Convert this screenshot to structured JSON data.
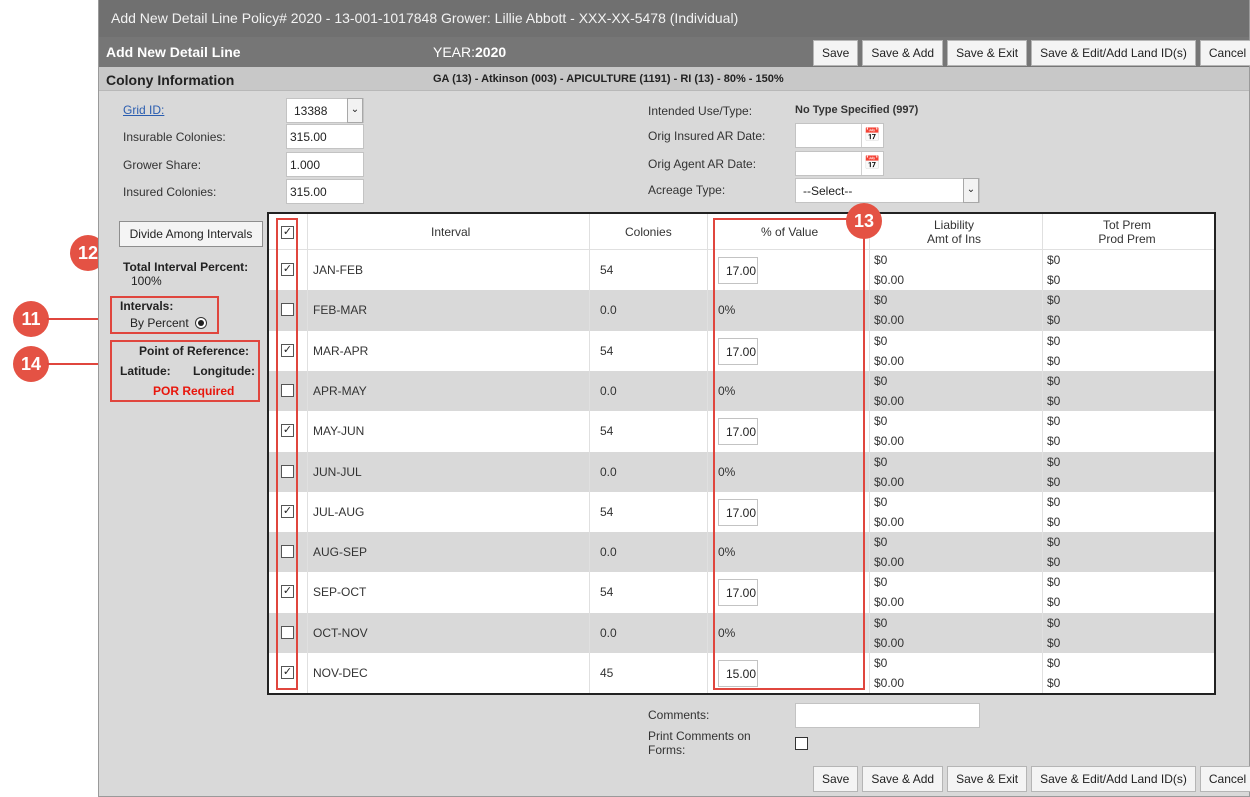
{
  "window_title": "Add New Detail Line Policy# 2020 - 13-001-1017848 Grower: Lillie Abbott - XXX-XX-5478 (Individual)",
  "header": {
    "title": "Add New Detail Line",
    "year_label": "YEAR:",
    "year_value": "2020",
    "buttons": [
      "Save",
      "Save & Add",
      "Save & Exit",
      "Save & Edit/Add Land ID(s)",
      "Cancel"
    ]
  },
  "section": {
    "title": "Colony Information",
    "info": "GA (13) - Atkinson (003) - APICULTURE (1191) - RI (13) - 80% - 150%"
  },
  "fields": {
    "grid_id_label": "Grid ID:",
    "grid_id_value": "13388",
    "insurable_colonies_label": "Insurable Colonies:",
    "insurable_colonies_value": "315.00",
    "grower_share_label": "Grower Share:",
    "grower_share_value": "1.000",
    "insured_colonies_label": "Insured Colonies:",
    "insured_colonies_value": "315.00",
    "intended_use_label": "Intended Use/Type:",
    "intended_use_value": "No Type Specified (997)",
    "orig_insured_ar_label": "Orig Insured AR Date:",
    "orig_agent_ar_label": "Orig Agent AR Date:",
    "acreage_type_label": "Acreage Type:",
    "acreage_type_value": "--Select--"
  },
  "left": {
    "divide_button": "Divide Among Intervals",
    "total_interval_label": "Total Interval Percent:",
    "total_interval_value": "100%",
    "intervals_label": "Intervals:",
    "by_percent_label": "By Percent",
    "por_label": "Point of Reference:",
    "latitude_label": "Latitude:",
    "longitude_label": "Longitude:",
    "por_required": "POR Required"
  },
  "table": {
    "headers": {
      "interval": "Interval",
      "colonies": "Colonies",
      "pct_value": "% of Value",
      "liability_1": "Liability",
      "liability_2": "Amt of Ins",
      "totprem_1": "Tot Prem",
      "totprem_2": "Prod Prem"
    },
    "rows": [
      {
        "interval": "JAN-FEB",
        "colonies": "54",
        "checked": true,
        "pct": "17.00",
        "liab1": "$0",
        "liab2": "$0.00",
        "prem1": "$0",
        "prem2": "$0"
      },
      {
        "interval": "FEB-MAR",
        "colonies": "0.0",
        "checked": false,
        "pct": "0%",
        "liab1": "$0",
        "liab2": "$0.00",
        "prem1": "$0",
        "prem2": "$0"
      },
      {
        "interval": "MAR-APR",
        "colonies": "54",
        "checked": true,
        "pct": "17.00",
        "liab1": "$0",
        "liab2": "$0.00",
        "prem1": "$0",
        "prem2": "$0"
      },
      {
        "interval": "APR-MAY",
        "colonies": "0.0",
        "checked": false,
        "pct": "0%",
        "liab1": "$0",
        "liab2": "$0.00",
        "prem1": "$0",
        "prem2": "$0"
      },
      {
        "interval": "MAY-JUN",
        "colonies": "54",
        "checked": true,
        "pct": "17.00",
        "liab1": "$0",
        "liab2": "$0.00",
        "prem1": "$0",
        "prem2": "$0"
      },
      {
        "interval": "JUN-JUL",
        "colonies": "0.0",
        "checked": false,
        "pct": "0%",
        "liab1": "$0",
        "liab2": "$0.00",
        "prem1": "$0",
        "prem2": "$0"
      },
      {
        "interval": "JUL-AUG",
        "colonies": "54",
        "checked": true,
        "pct": "17.00",
        "liab1": "$0",
        "liab2": "$0.00",
        "prem1": "$0",
        "prem2": "$0"
      },
      {
        "interval": "AUG-SEP",
        "colonies": "0.0",
        "checked": false,
        "pct": "0%",
        "liab1": "$0",
        "liab2": "$0.00",
        "prem1": "$0",
        "prem2": "$0"
      },
      {
        "interval": "SEP-OCT",
        "colonies": "54",
        "checked": true,
        "pct": "17.00",
        "liab1": "$0",
        "liab2": "$0.00",
        "prem1": "$0",
        "prem2": "$0"
      },
      {
        "interval": "OCT-NOV",
        "colonies": "0.0",
        "checked": false,
        "pct": "0%",
        "liab1": "$0",
        "liab2": "$0.00",
        "prem1": "$0",
        "prem2": "$0"
      },
      {
        "interval": "NOV-DEC",
        "colonies": "45",
        "checked": true,
        "pct": "15.00",
        "liab1": "$0",
        "liab2": "$0.00",
        "prem1": "$0",
        "prem2": "$0"
      }
    ]
  },
  "footer": {
    "comments_label": "Comments:",
    "print_comments_label_1": "Print Comments on",
    "print_comments_label_2": "Forms:"
  },
  "callouts": [
    "12",
    "11",
    "14",
    "13"
  ],
  "colors": {
    "accent": "#e45244",
    "header": "#767676",
    "title": "#707070",
    "por_required": "#e8160c"
  }
}
